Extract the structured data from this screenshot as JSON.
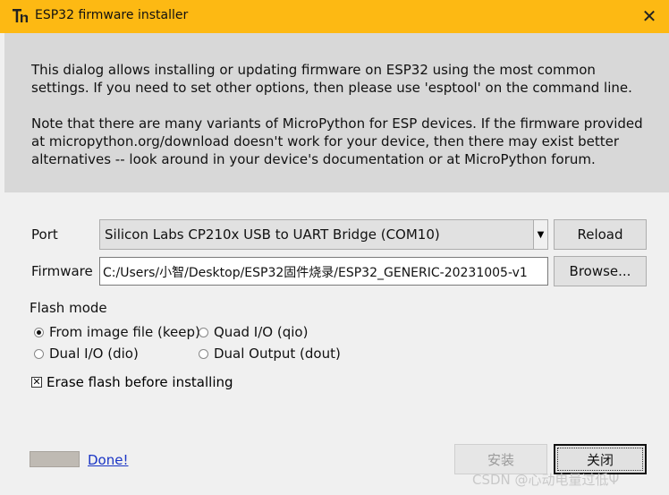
{
  "window": {
    "title": "ESP32 firmware installer",
    "close_label": "✕",
    "app_icon": "thonny-logo-icon"
  },
  "intro": {
    "paragraph1": "This dialog allows installing or updating firmware on ESP32 using the most common settings. If you need to set other options, then please use 'esptool' on the command line.",
    "paragraph2": "Note that there are many variants of MicroPython for ESP devices. If the firmware provided at micropython.org/download doesn't work for your device, then there may exist better alternatives -- look around in your device's documentation or at MicroPython forum."
  },
  "port": {
    "label": "Port",
    "value": "Silicon Labs CP210x USB to UART Bridge (COM10)",
    "reload_label": "Reload"
  },
  "firmware": {
    "label": "Firmware",
    "value": "C:/Users/小智/Desktop/ESP32固件烧录/ESP32_GENERIC-20231005-v1",
    "browse_label": "Browse..."
  },
  "flash_mode": {
    "label": "Flash mode",
    "options": [
      {
        "label": "From image file (keep)",
        "selected": true
      },
      {
        "label": "Quad I/O (qio)",
        "selected": false
      },
      {
        "label": "Dual I/O (dio)",
        "selected": false
      },
      {
        "label": "Dual Output (dout)",
        "selected": false
      }
    ]
  },
  "erase": {
    "label": "Erase flash before installing",
    "checked": true
  },
  "footer": {
    "done_link": "Done!",
    "install_label": "安装",
    "close_label": "关闭",
    "watermark": "CSDN @心动电量过低Ψ"
  },
  "colors": {
    "titlebar": "#fdb913",
    "intro_bg": "#d8d8d8",
    "link": "#1a35c5"
  }
}
